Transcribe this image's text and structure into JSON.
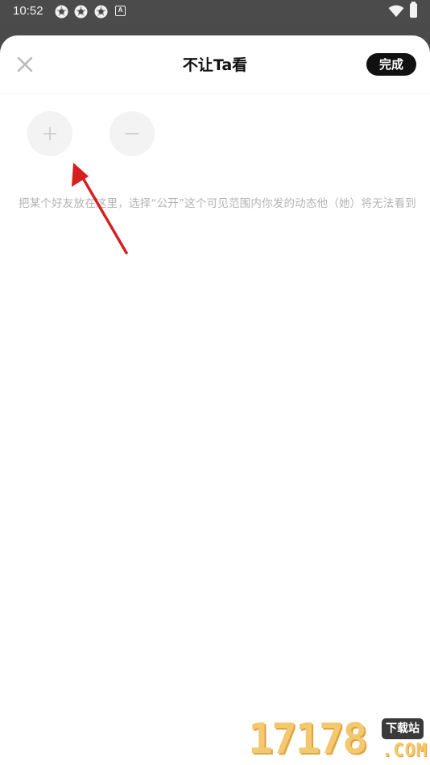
{
  "status_bar": {
    "time": "10:52",
    "app_icons": [
      "app-notification-icon",
      "app-notification-icon",
      "app-notification-icon",
      "a-badge-icon"
    ],
    "a_badge": "A",
    "wifi_icon": "wifi-icon",
    "battery_icon": "battery-icon"
  },
  "header": {
    "close_icon": "close-icon",
    "title": "不让Ta看",
    "done_label": "完成"
  },
  "actions": {
    "add_icon": "plus-icon",
    "remove_icon": "minus-icon"
  },
  "hint_text": "把某个好友放在这里，选择“公开”这个可见范围内你发的动态他（她）将无法看到",
  "annotation": {
    "arrow_color": "#d62020"
  },
  "watermark": {
    "number": "17178",
    "badge": "下载站",
    "domain": ".COM"
  },
  "colors": {
    "overlay": "#4a4a4a",
    "sheet": "#ffffff",
    "done_button": "#111111",
    "hint_text": "#b4b4b4",
    "circle_button": "#f3f3f3"
  }
}
